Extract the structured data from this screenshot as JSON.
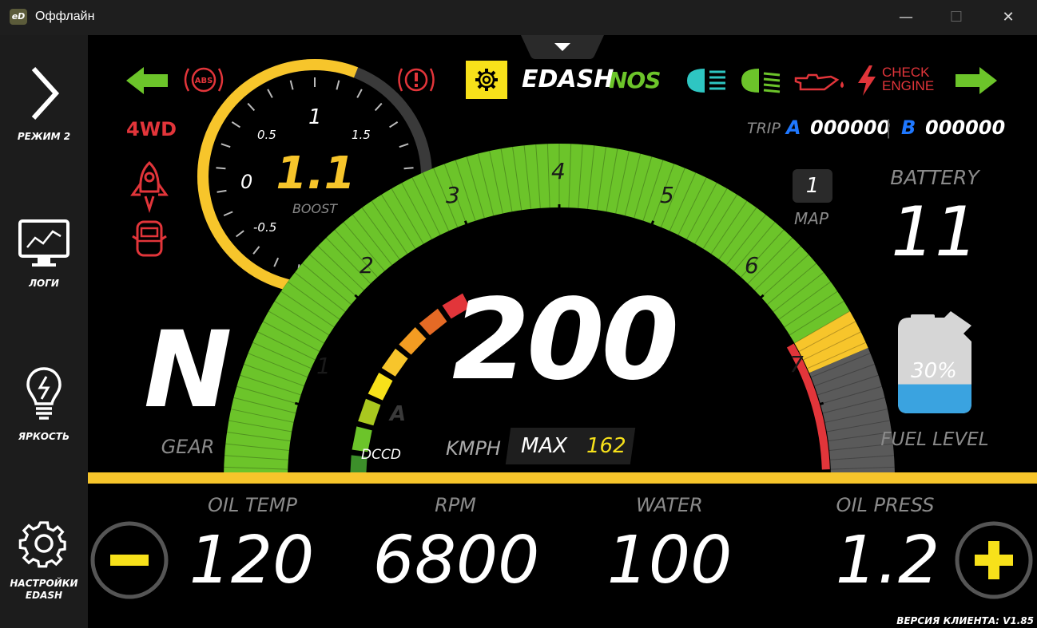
{
  "window": {
    "title": "Оффлайн",
    "app_icon_text": "eD",
    "minimize": "—",
    "maximize": "☐",
    "close": "✕"
  },
  "sidebar": {
    "items": [
      {
        "label": "РЕЖИМ 2",
        "icon": "chevron-right-icon"
      },
      {
        "label": "ЛОГИ",
        "icon": "monitor-chart-icon"
      },
      {
        "label": "ЯРКОСТЬ",
        "icon": "lightbulb-icon"
      },
      {
        "label": "НАСТРОЙКИ EDASH",
        "icon": "gear-icon"
      }
    ]
  },
  "top_icons": {
    "abs": "ABS",
    "brand": "EDASH",
    "nos": "NOS",
    "check_engine": "CHECK ENGINE"
  },
  "status": {
    "drive_mode": "4WD"
  },
  "trip": {
    "label": "TRIP",
    "a_label": "A",
    "a_value": "000000",
    "sep": "|",
    "b_label": "B",
    "b_value": "000000"
  },
  "boost": {
    "value": "1.1",
    "label": "BOOST",
    "ticks": [
      "-0.5",
      "0",
      "0.5",
      "1",
      "1.5"
    ],
    "level": 0.62
  },
  "tach": {
    "ticks": [
      "1",
      "2",
      "3",
      "4",
      "5",
      "6",
      "7"
    ],
    "dccd_label": "DCCD",
    "dccd_mode": "A"
  },
  "speed": {
    "value": "200",
    "unit": "KMPH",
    "max_label": "MAX",
    "max_value": "162"
  },
  "map": {
    "value": "1",
    "label": "MAP"
  },
  "gear": {
    "value": "N",
    "label": "GEAR"
  },
  "battery": {
    "label": "BATTERY",
    "value": "11"
  },
  "fuel": {
    "label": "FUEL LEVEL",
    "value": "30%",
    "level": 0.3
  },
  "bottom": {
    "oil_temp": {
      "label": "OIL TEMP",
      "value": "120"
    },
    "rpm": {
      "label": "RPM",
      "value": "6800"
    },
    "water": {
      "label": "WATER",
      "value": "100"
    },
    "oil_press": {
      "label": "OIL PRESS",
      "value": "1.2"
    }
  },
  "version": "ВЕРСИЯ КЛИЕНТА: V1.85",
  "colors": {
    "green": "#6cc42a",
    "yellow": "#f7c52b",
    "red": "#e2353a",
    "teal": "#2ec6c2",
    "blue": "#1f78ff"
  }
}
